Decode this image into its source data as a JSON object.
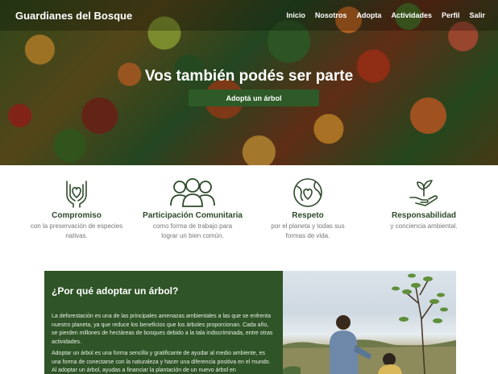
{
  "site": {
    "brand": "Guardianes del Bosque"
  },
  "nav": [
    "Inicio",
    "Nosotros",
    "Adopta",
    "Actividades",
    "Perfil",
    "Salir"
  ],
  "hero": {
    "title": "Vos también podés ser parte",
    "cta": "Adoptá un árbol"
  },
  "values": [
    {
      "icon": "hands-heart-icon",
      "title": "Compromiso",
      "desc": [
        "con la preservación de especies",
        "nativas."
      ]
    },
    {
      "icon": "community-icon",
      "title": "Participación Comunitaria",
      "desc": [
        "como forma de trabajo para",
        "lograr un bien común."
      ]
    },
    {
      "icon": "globe-heart-icon",
      "title": "Respeto",
      "desc": [
        "por el planeta y todas sus",
        "formas de vida."
      ]
    },
    {
      "icon": "plant-hand-icon",
      "title": "Responsabilidad",
      "desc": [
        "y conciencia ambiental."
      ]
    }
  ],
  "why": {
    "title": "¿Por qué adoptar un árbol?",
    "p1": "La deforestación es una de las principales amenazas ambientales a las que se enfrenta nuestro planeta, ya que reduce los beneficios que los árboles proporcionan. Cada año, se pierden millones de hectáreas de bosques debido a la tala indiscriminada, entre otras actividades.",
    "p2": "Adoptar un árbol es una forma sencilla y gratificante de ayudar al medio ambiente, es una forma de conectarse con la naturaleza y hacer una diferencia positiva en el mundo. Al adoptar un árbol, ayudas a financiar la plantación de un nuevo árbol en"
  },
  "colors": {
    "green": "#2e5a28",
    "dark_green": "#2f5427",
    "text_green": "#2e4a2a"
  }
}
